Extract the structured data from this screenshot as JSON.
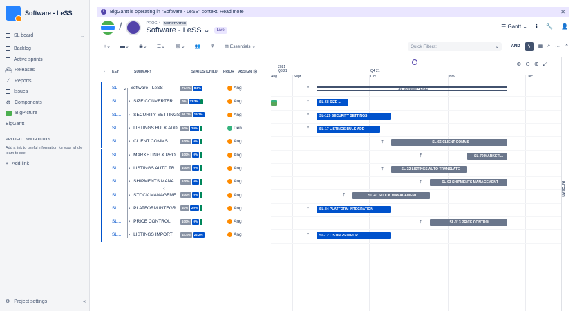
{
  "project": {
    "name": "Software - LeSS"
  },
  "sidebar": {
    "items": [
      {
        "label": "SL board",
        "icon": "board-icon"
      },
      {
        "label": "Backlog",
        "icon": "backlog-icon"
      },
      {
        "label": "Active sprints",
        "icon": "sprint-icon"
      },
      {
        "label": "Releases",
        "icon": "ship-icon"
      },
      {
        "label": "Reports",
        "icon": "chart-icon"
      },
      {
        "label": "Issues",
        "icon": "issues-icon"
      },
      {
        "label": "Components",
        "icon": "component-icon"
      },
      {
        "label": "BigPicture",
        "icon": "bigpicture-icon"
      },
      {
        "label": "BigGantt",
        "icon": "biggantt-icon"
      }
    ],
    "shortcuts_title": "PROJECT SHORTCUTS",
    "shortcuts_text": "Add a link to useful information for your whole team to see.",
    "add_link": "Add link",
    "settings": "Project settings"
  },
  "banner": {
    "text": "BigGantt is operating in \"Software - LeSS\" context. Read more"
  },
  "header": {
    "key": "PROG-4",
    "status": "NOT STARTED",
    "title": "Software - LeSS",
    "live": "Live",
    "view": "Gantt"
  },
  "toolbar": {
    "essentials": "Essentials",
    "quick_filters": "Quick Filters:",
    "and": "AND"
  },
  "table": {
    "headers": [
      "KEY",
      "SUMMARY",
      "STATUS [CHILD]",
      "PRIOR",
      "ASSIGN"
    ],
    "rows": [
      {
        "key": "SL",
        "summary": "Software - LeSS",
        "s": [
          "77.9%",
          "8.8%"
        ],
        "a": "Ang"
      },
      {
        "key": "SL...",
        "summary": "SIZE CONVERTER",
        "s": [
          "0%",
          "33.3%",
          ""
        ],
        "a": "Ang"
      },
      {
        "key": "SL...",
        "summary": "SECURITY SETTINGS",
        "s": [
          "66.7%",
          "16.7%"
        ],
        "a": "Ang"
      },
      {
        "key": "SL...",
        "summary": "LISTINGS BULK ADD",
        "s": [
          "60%",
          "20%",
          ""
        ],
        "a": "Den"
      },
      {
        "key": "SL...",
        "summary": "CLIENT COMMS",
        "s": [
          "100%",
          "0%",
          ""
        ],
        "a": "Ang"
      },
      {
        "key": "SL...",
        "summary": "MARKETING & PRO...",
        "s": [
          "100%",
          "0%",
          ""
        ],
        "a": "Ang"
      },
      {
        "key": "SL...",
        "summary": "LISTINGS AUTO TR...",
        "s": [
          "100%",
          "0%",
          ""
        ],
        "a": "Ang"
      },
      {
        "key": "SL...",
        "summary": "SHIPMENTS MANA...",
        "s": [
          "100%",
          "0%",
          ""
        ],
        "a": "Ang"
      },
      {
        "key": "SL...",
        "summary": "STOCK MANAGEME...",
        "s": [
          "100%",
          "0%",
          ""
        ],
        "a": "Ang"
      },
      {
        "key": "SL...",
        "summary": "PLATFORM INTEGR...",
        "s": [
          "40%",
          "20%",
          ""
        ],
        "a": "Ang"
      },
      {
        "key": "SL...",
        "summary": "PRICE CONTROL",
        "s": [
          "100%",
          "0%",
          ""
        ],
        "a": "Ang"
      },
      {
        "key": "SL...",
        "summary": "LISTINGS IMPORT",
        "s": [
          "44.4%",
          "22.2%"
        ],
        "a": "Ang"
      }
    ]
  },
  "gantt": {
    "year": "2021",
    "quarter1": "Q3 21",
    "quarter2": "Q4 21",
    "months": [
      "Aug",
      "Sept",
      "Oct",
      "Nov",
      "Dec"
    ],
    "bars": [
      "SL  Software - LeSS",
      "SL-58  SIZE ...",
      "SL-129  SECURITY SETTINGS",
      "SL-17  LISTINGS BULK ADD",
      "SL-66  CLIENT COMMS",
      "SL-70  MARKETI...",
      "SL-32  LISTINGS AUTO TRANSLATE",
      "SL-93  SHIPMENTS MANAGEMENT",
      "SL-41  STOCK MANAGEMENT",
      "SL-84  PLATFORM INTEGRATION",
      "SL-113  PRICE CONTROL",
      "SL-12  LISTINGS IMPORT"
    ]
  },
  "infobar": "INFOBAR"
}
